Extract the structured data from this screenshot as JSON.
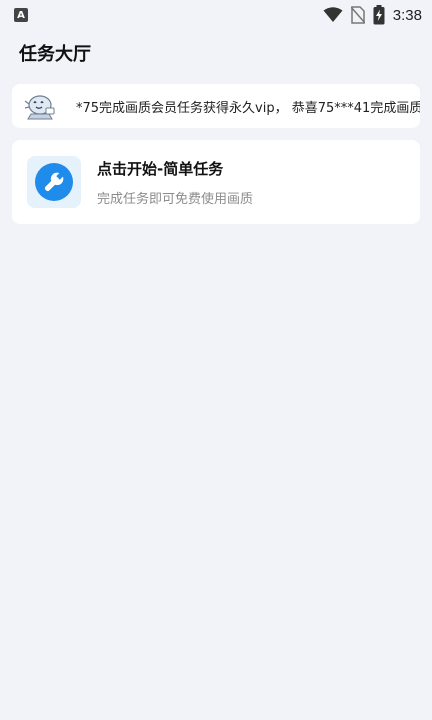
{
  "status_bar": {
    "app_badge": "A",
    "time": "3:38",
    "icons": [
      "wifi-icon",
      "no-sim-icon",
      "battery-charging-icon"
    ]
  },
  "page": {
    "title": "任务大厅"
  },
  "marquee": {
    "icon": "robot-mascot-icon",
    "text": "*75完成画质会员任务获得永久vip， 恭喜75***41完成画质会"
  },
  "task": {
    "icon": "wrench-icon",
    "title": "点击开始-简单任务",
    "subtitle": "完成任务即可免费使用画质",
    "accent_color": "#1f8bea",
    "icon_bg_color": "#e6f2fb"
  }
}
